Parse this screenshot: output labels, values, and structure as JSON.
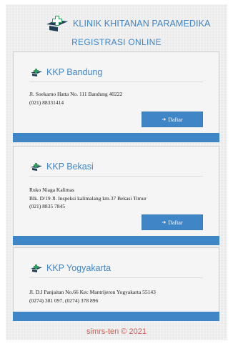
{
  "header": {
    "brand": "KLINIK KHITANAN PARAMEDIKA",
    "subtitle": "REGISTRASI ONLINE"
  },
  "clinics": [
    {
      "title": "KKP Bandung",
      "address_line1": "Jl. Soekarno Hatta No. 111 Bandung 40222",
      "address_line2": "(021) 88331414",
      "button_label": "Daftar"
    },
    {
      "title": "KKP Bekasi",
      "address_line1": "Ruko Niaga Kalimas",
      "address_line2": "Blk. D/19 Jl. Inspeksi kalimalang km.37 Bekasi Timur",
      "address_line3": "(021) 8835 7845",
      "button_label": "Daftar"
    },
    {
      "title": "KKP Yogyakarta",
      "address_line1": "Jl. D.I Panjaitan No.66 Kec Mantrijeron Yogyakarta 55143",
      "address_line2": "(0274) 381 097, (0274) 378 896"
    }
  ],
  "footer": {
    "text": "simrs-ten © 2021"
  },
  "colors": {
    "accent": "#3f86c6",
    "logo_dark": "#1f3f57",
    "logo_green": "#2aa05a",
    "footer_text": "#cc5a4e"
  },
  "icons": {
    "button_icon": "sign-in-icon",
    "clinic_icon": "clinic-cross-logo-icon"
  }
}
